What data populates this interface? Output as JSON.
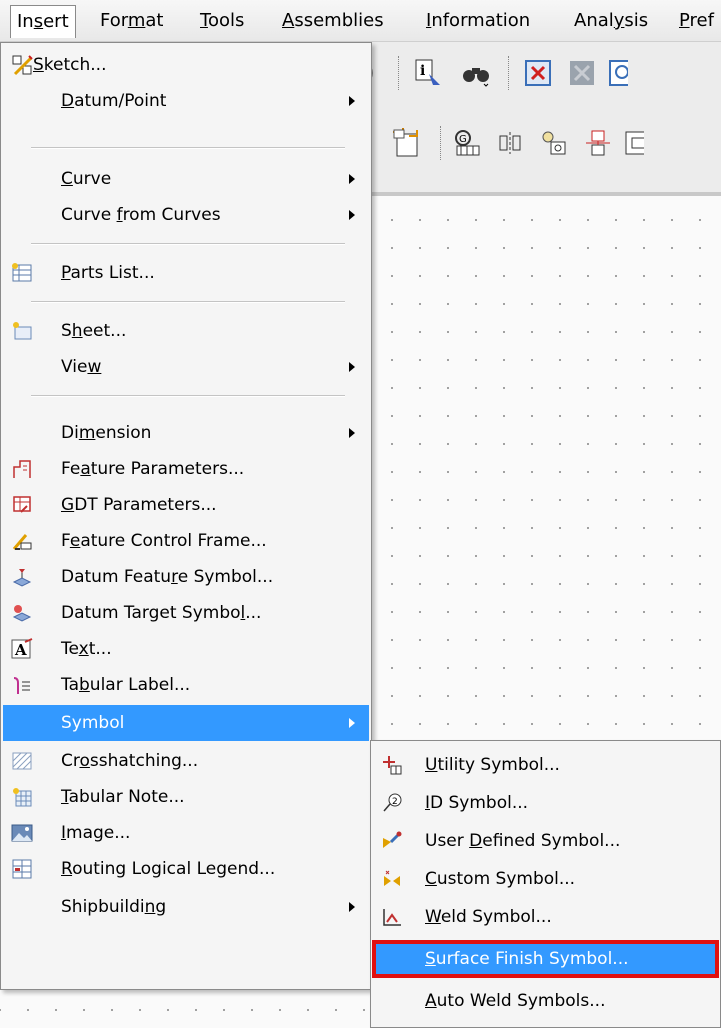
{
  "menubar": {
    "items": [
      {
        "pre": "In",
        "u": "s",
        "post": "ert"
      },
      {
        "pre": "For",
        "u": "m",
        "post": "at"
      },
      {
        "pre": "",
        "u": "T",
        "post": "ools"
      },
      {
        "pre": "",
        "u": "A",
        "post": "ssemblies"
      },
      {
        "pre": "",
        "u": "I",
        "post": "nformation"
      },
      {
        "pre": "Anal",
        "u": "y",
        "post": "sis"
      },
      {
        "pre": "",
        "u": "P",
        "post": "ref"
      }
    ]
  },
  "insert_menu": {
    "items": [
      {
        "pre": "",
        "u": "S",
        "post": "ketch...",
        "icon": "sketch-icon"
      },
      {
        "pre": "",
        "u": "D",
        "post": "atum/Point",
        "arrow": true
      },
      {
        "pre": "",
        "u": "C",
        "post": "urve",
        "arrow": true
      },
      {
        "pre": "Curve ",
        "u": "f",
        "post": "rom Curves",
        "arrow": true
      },
      {
        "pre": "",
        "u": "P",
        "post": "arts List...",
        "icon": "parts-list-icon"
      },
      {
        "pre": "S",
        "u": "h",
        "post": "eet...",
        "icon": "sheet-icon"
      },
      {
        "pre": "Vie",
        "u": "w",
        "post": "",
        "arrow": true
      },
      {
        "pre": "Di",
        "u": "m",
        "post": "ension",
        "arrow": true
      },
      {
        "pre": "Fe",
        "u": "a",
        "post": "ture Parameters...",
        "icon": "feature-parameters-icon"
      },
      {
        "pre": "",
        "u": "G",
        "post": "DT Parameters...",
        "icon": "gdt-parameters-icon"
      },
      {
        "pre": "F",
        "u": "e",
        "post": "ature Control Frame...",
        "icon": "feature-control-frame-icon"
      },
      {
        "pre": "Datum Featu",
        "u": "r",
        "post": "e Symbol...",
        "icon": "datum-feature-symbol-icon"
      },
      {
        "pre": "Datum Target Symbo",
        "u": "l",
        "post": "...",
        "icon": "datum-target-symbol-icon"
      },
      {
        "pre": "Te",
        "u": "x",
        "post": "t...",
        "icon": "text-icon"
      },
      {
        "pre": "Ta",
        "u": "b",
        "post": "ular Label...",
        "icon": "tabular-label-icon"
      },
      {
        "pre": "Symbol",
        "u": "",
        "post": "",
        "arrow": true,
        "highlight": true
      },
      {
        "pre": "Cr",
        "u": "o",
        "post": "sshatching...",
        "icon": "crosshatching-icon"
      },
      {
        "pre": "",
        "u": "T",
        "post": "abular Note...",
        "icon": "tabular-note-icon"
      },
      {
        "pre": "",
        "u": "I",
        "post": "mage...",
        "icon": "image-icon"
      },
      {
        "pre": "",
        "u": "R",
        "post": "outing Logical Legend...",
        "icon": "routing-legend-icon"
      },
      {
        "pre": "Shipbuildi",
        "u": "n",
        "post": "g",
        "arrow": true
      }
    ]
  },
  "symbol_submenu": {
    "items": [
      {
        "pre": "",
        "u": "U",
        "post": "tility Symbol...",
        "icon": "utility-symbol-icon"
      },
      {
        "pre": "",
        "u": "I",
        "post": "D Symbol...",
        "icon": "id-symbol-icon"
      },
      {
        "pre": "User ",
        "u": "D",
        "post": "efined Symbol...",
        "icon": "user-defined-symbol-icon"
      },
      {
        "pre": "",
        "u": "C",
        "post": "ustom Symbol...",
        "icon": "custom-symbol-icon"
      },
      {
        "pre": "",
        "u": "W",
        "post": "eld Symbol...",
        "icon": "weld-symbol-icon"
      },
      {
        "pre": "",
        "u": "S",
        "post": "urface Finish Symbol...",
        "selected": true
      },
      {
        "pre": "",
        "u": "A",
        "post": "uto Weld Symbols..."
      }
    ]
  },
  "colors": {
    "highlight": "#3399ff",
    "selection_outline": "#e01010"
  }
}
